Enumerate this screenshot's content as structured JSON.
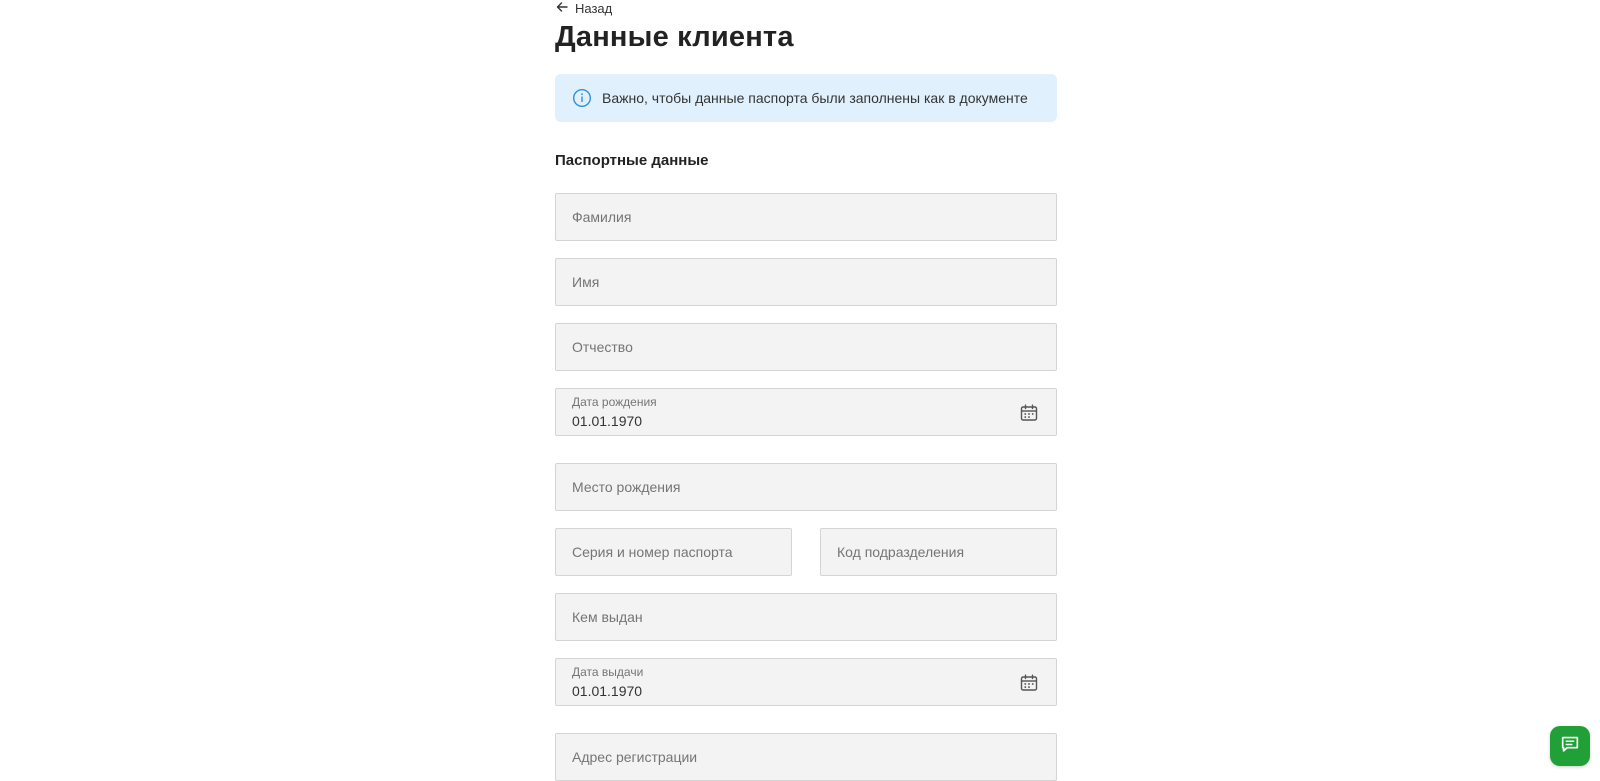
{
  "nav": {
    "back_label": "Назад"
  },
  "page": {
    "title": "Данные клиента"
  },
  "notice": {
    "text": "Важно, чтобы данные паспорта были заполнены как в документе"
  },
  "section": {
    "title": "Паспортные данные"
  },
  "fields": {
    "last_name": {
      "placeholder": "Фамилия"
    },
    "first_name": {
      "placeholder": "Имя"
    },
    "patronymic": {
      "placeholder": "Отчество"
    },
    "birth_date": {
      "label": "Дата рождения",
      "value": "01.01.1970"
    },
    "birth_place": {
      "placeholder": "Место рождения"
    },
    "passport_number": {
      "placeholder": "Серия и номер паспорта"
    },
    "division_code": {
      "placeholder": "Код подразделения"
    },
    "issued_by": {
      "placeholder": "Кем выдан"
    },
    "issue_date": {
      "label": "Дата выдачи",
      "value": "01.01.1970"
    },
    "registration_address": {
      "placeholder": "Адрес регистрации"
    }
  },
  "icons": {
    "back": "arrow-left-icon",
    "info": "info-icon",
    "calendar": "calendar-icon",
    "chat": "chat-icon"
  },
  "colors": {
    "notice_bg": "#e0f1fd",
    "info_icon": "#2f8fd8",
    "field_bg": "#f3f3f3",
    "chat_button": "#21a038"
  }
}
